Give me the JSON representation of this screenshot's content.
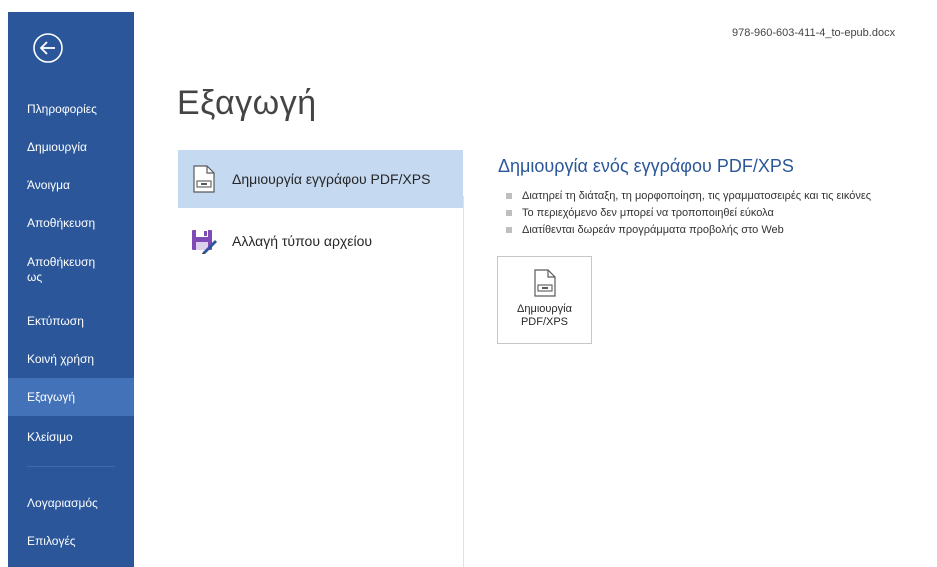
{
  "document": {
    "filename": "978-960-603-411-4_to-epub.docx"
  },
  "sidebar": {
    "back_icon": "back-arrow-icon",
    "items": [
      {
        "label": "Πληροφορίες"
      },
      {
        "label": "Δημιουργία"
      },
      {
        "label": "Άνοιγμα"
      },
      {
        "label": "Αποθήκευση"
      },
      {
        "label": "Αποθήκευση ως"
      },
      {
        "label": "Εκτύπωση"
      },
      {
        "label": "Κοινή χρήση"
      },
      {
        "label": "Εξαγωγή",
        "selected": true
      },
      {
        "label": "Κλείσιμο"
      },
      {
        "label": "Λογαριασμός"
      },
      {
        "label": "Επιλογές"
      }
    ],
    "colors": {
      "background": "#2b579a",
      "selected": "#4472b8"
    }
  },
  "main": {
    "title": "Εξαγωγή",
    "options": [
      {
        "label": "Δημιουργία εγγράφου PDF/XPS",
        "icon": "pdf-document-icon",
        "selected": true
      },
      {
        "label": "Αλλαγή τύπου αρχείου",
        "icon": "change-file-type-icon",
        "selected": false
      }
    ],
    "detail": {
      "heading": "Δημιουργία ενός εγγράφου PDF/XPS",
      "bullets": [
        "Διατηρεί τη διάταξη, τη μορφοποίηση, τις γραμματοσειρές και τις εικόνες",
        "Το περιεχόμενο δεν μπορεί να τροποποιηθεί εύκολα",
        "Διατίθενται δωρεάν προγράμματα προβολής στο Web"
      ],
      "button": {
        "line1": "Δημιουργία",
        "line2": "PDF/XPS",
        "icon": "pdf-document-icon"
      }
    },
    "colors": {
      "accent": "#2b579a",
      "selected_option": "#c5d9f1"
    }
  }
}
